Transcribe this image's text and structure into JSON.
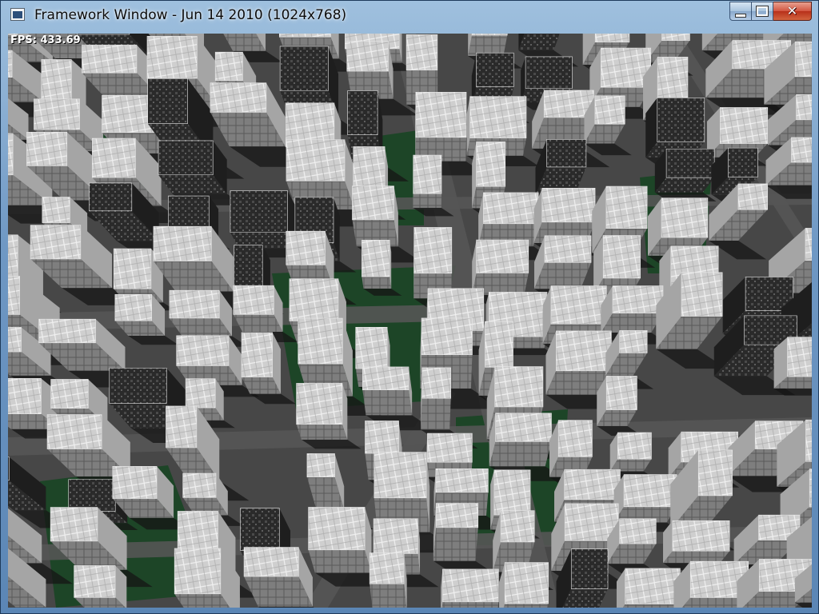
{
  "window": {
    "title": "Framework Window - Jun 14 2010 (1024x768)",
    "controls": {
      "minimize": "minimize",
      "maximize": "maximize",
      "close": "close"
    }
  },
  "scene": {
    "fps_text": "FPS: 433.69",
    "colors": {
      "road": "#4a4a4a",
      "grass": "#1f4a2a",
      "roof": "#d2d2d2",
      "wall": "#8c8c8c",
      "shadow": "#1a1a1a"
    }
  }
}
